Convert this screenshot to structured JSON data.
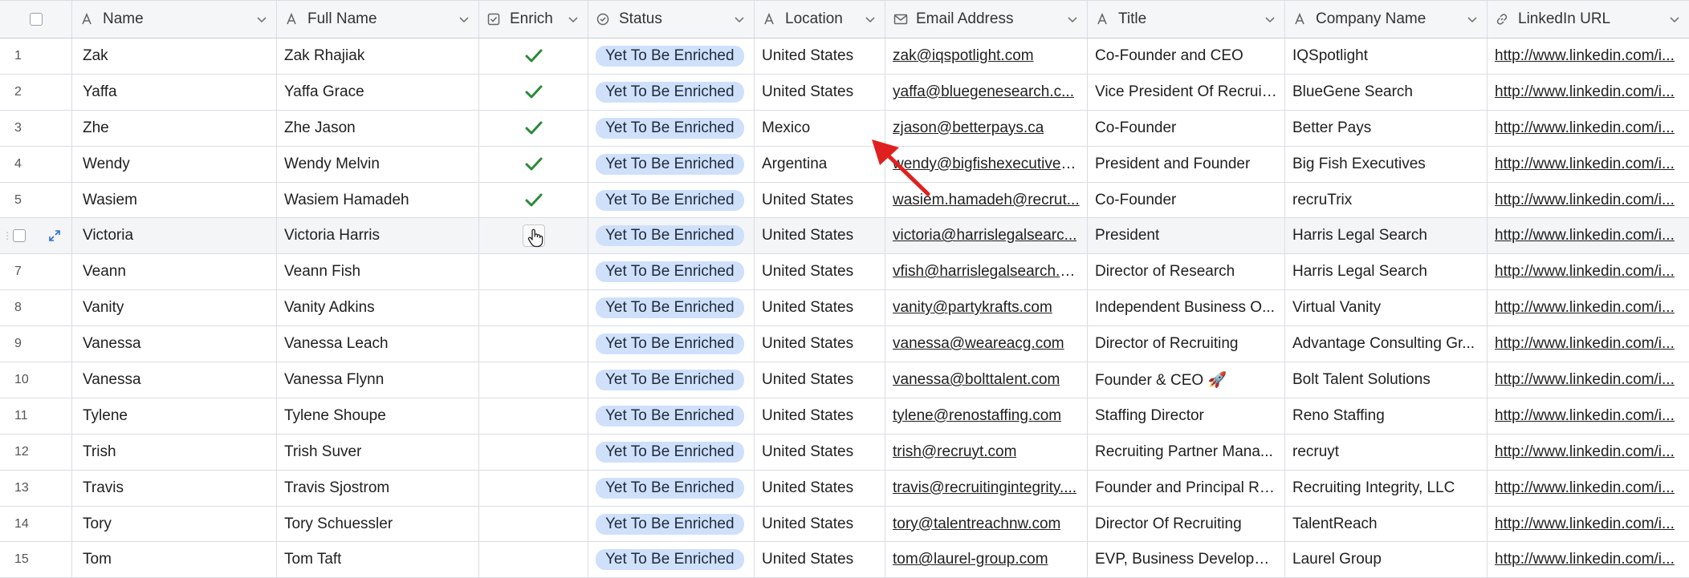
{
  "columns": [
    {
      "label": "Name",
      "icon": "text-type-icon"
    },
    {
      "label": "Full Name",
      "icon": "text-type-icon"
    },
    {
      "label": "Enrich",
      "icon": "checkbox-type-icon"
    },
    {
      "label": "Status",
      "icon": "status-type-icon"
    },
    {
      "label": "Location",
      "icon": "text-type-icon"
    },
    {
      "label": "Email Address",
      "icon": "email-type-icon"
    },
    {
      "label": "Title",
      "icon": "text-type-icon"
    },
    {
      "label": "Company Name",
      "icon": "text-type-icon"
    },
    {
      "label": "LinkedIn URL",
      "icon": "link-type-icon"
    }
  ],
  "rows": [
    {
      "num": "1",
      "name": "Zak",
      "full_name": "Zak Rhajiak",
      "enriched": true,
      "status": "Yet To Be Enriched",
      "location": "United States",
      "email": "zak@iqspotlight.com",
      "title": "Co-Founder and CEO",
      "company": "IQSpotlight",
      "linkedin": "http://www.linkedin.com/i..."
    },
    {
      "num": "2",
      "name": "Yaffa",
      "full_name": "Yaffa Grace",
      "enriched": true,
      "status": "Yet To Be Enriched",
      "location": "United States",
      "email": "yaffa@bluegenesearch.c...",
      "title": "Vice President Of Recruit...",
      "company": "BlueGene Search",
      "linkedin": "http://www.linkedin.com/i..."
    },
    {
      "num": "3",
      "name": "Zhe",
      "full_name": "Zhe Jason",
      "enriched": true,
      "status": "Yet To Be Enriched",
      "location": "Mexico",
      "email": "zjason@betterpays.ca",
      "title": "Co-Founder",
      "company": "Better Pays",
      "linkedin": "http://www.linkedin.com/i..."
    },
    {
      "num": "4",
      "name": "Wendy",
      "full_name": "Wendy Melvin",
      "enriched": true,
      "status": "Yet To Be Enriched",
      "location": "Argentina",
      "email": "wendy@bigfishexecutives...",
      "title": "President and Founder",
      "company": "Big Fish Executives",
      "linkedin": "http://www.linkedin.com/i..."
    },
    {
      "num": "5",
      "name": "Wasiem",
      "full_name": "Wasiem Hamadeh",
      "enriched": true,
      "status": "Yet To Be Enriched",
      "location": "United States",
      "email": "wasiem.hamadeh@recrut...",
      "title": "Co-Founder",
      "company": "recruTrix",
      "linkedin": "http://www.linkedin.com/i..."
    },
    {
      "num": "6",
      "name": "Victoria",
      "full_name": "Victoria Harris",
      "enriched": false,
      "status": "Yet To Be Enriched",
      "location": "United States",
      "email": "victoria@harrislegalsearc...",
      "title": "President",
      "company": "Harris Legal Search",
      "linkedin": "http://www.linkedin.com/i..."
    },
    {
      "num": "7",
      "name": "Veann",
      "full_name": "Veann Fish",
      "enriched": false,
      "status": "Yet To Be Enriched",
      "location": "United States",
      "email": "vfish@harrislegalsearch.c...",
      "title": "Director of Research",
      "company": "Harris Legal Search",
      "linkedin": "http://www.linkedin.com/i..."
    },
    {
      "num": "8",
      "name": "Vanity",
      "full_name": "Vanity Adkins",
      "enriched": false,
      "status": "Yet To Be Enriched",
      "location": "United States",
      "email": "vanity@partykrafts.com",
      "title": "Independent Business O...",
      "company": "Virtual Vanity",
      "linkedin": "http://www.linkedin.com/i..."
    },
    {
      "num": "9",
      "name": "Vanessa",
      "full_name": "Vanessa Leach",
      "enriched": false,
      "status": "Yet To Be Enriched",
      "location": "United States",
      "email": "vanessa@weareacg.com",
      "title": "Director of Recruiting",
      "company": "Advantage Consulting Gr...",
      "linkedin": "http://www.linkedin.com/i..."
    },
    {
      "num": "10",
      "name": "Vanessa",
      "full_name": "Vanessa Flynn",
      "enriched": false,
      "status": "Yet To Be Enriched",
      "location": "United States",
      "email": "vanessa@bolttalent.com",
      "title": "Founder & CEO 🚀",
      "company": "Bolt Talent Solutions",
      "linkedin": "http://www.linkedin.com/i..."
    },
    {
      "num": "11",
      "name": "Tylene",
      "full_name": "Tylene Shoupe",
      "enriched": false,
      "status": "Yet To Be Enriched",
      "location": "United States",
      "email": "tylene@renostaffing.com",
      "title": "Staffing Director",
      "company": "Reno Staffing",
      "linkedin": "http://www.linkedin.com/i..."
    },
    {
      "num": "12",
      "name": "Trish",
      "full_name": "Trish Suver",
      "enriched": false,
      "status": "Yet To Be Enriched",
      "location": "United States",
      "email": "trish@recruyt.com",
      "title": "Recruiting Partner Mana...",
      "company": "recruyt",
      "linkedin": "http://www.linkedin.com/i..."
    },
    {
      "num": "13",
      "name": "Travis",
      "full_name": "Travis Sjostrom",
      "enriched": false,
      "status": "Yet To Be Enriched",
      "location": "United States",
      "email": "travis@recruitingintegrity....",
      "title": "Founder and Principal Re...",
      "company": "Recruiting Integrity, LLC",
      "linkedin": "http://www.linkedin.com/i..."
    },
    {
      "num": "14",
      "name": "Tory",
      "full_name": "Tory Schuessler",
      "enriched": false,
      "status": "Yet To Be Enriched",
      "location": "United States",
      "email": "tory@talentreachnw.com",
      "title": "Director Of Recruiting",
      "company": "TalentReach",
      "linkedin": "http://www.linkedin.com/i..."
    },
    {
      "num": "15",
      "name": "Tom",
      "full_name": "Tom Taft",
      "enriched": false,
      "status": "Yet To Be Enriched",
      "location": "United States",
      "email": "tom@laurel-group.com",
      "title": "EVP, Business Developm...",
      "company": "Laurel Group",
      "linkedin": "http://www.linkedin.com/i..."
    }
  ],
  "hovered_row_index": 5,
  "colors": {
    "status_pill": "#cfe0fb",
    "check": "#2c8a3a",
    "annotation_arrow": "#e0201e"
  }
}
